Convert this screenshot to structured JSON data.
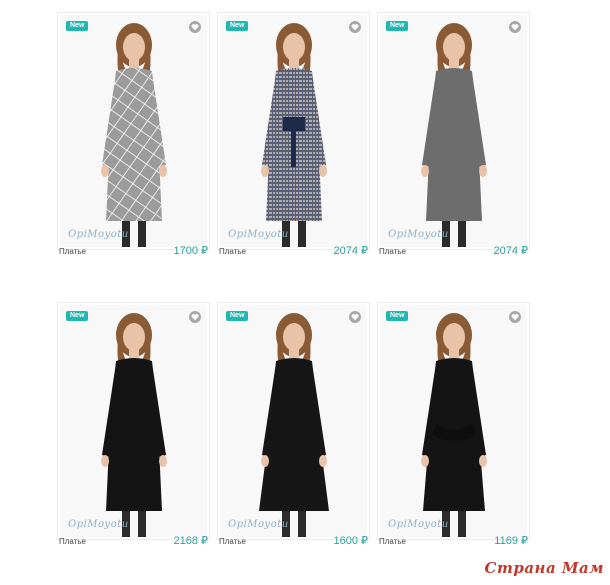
{
  "products": [
    {
      "badge": "New",
      "brand": "OpiMoyotu",
      "name": "Платье",
      "price": "1700 ₽",
      "dress": "#9b9b9b",
      "accent": "#ffffff"
    },
    {
      "badge": "New",
      "brand": "OpiMoyotu",
      "name": "Платье",
      "price": "2074 ₽",
      "dress": "#5a5f78",
      "accent": "#e8dcc8"
    },
    {
      "badge": "New",
      "brand": "OpiMoyotu",
      "name": "Платье",
      "price": "2074 ₽",
      "dress": "#6d6d6d",
      "accent": "#5a5a5a"
    },
    {
      "badge": "New",
      "brand": "OpiMoyotu",
      "name": "Платье",
      "price": "2168 ₽",
      "dress": "#141414",
      "accent": "#2a2a2a"
    },
    {
      "badge": "New",
      "brand": "OpiMoyotu",
      "name": "Платье",
      "price": "1600 ₽",
      "dress": "#161616",
      "accent": "#2a2a2a"
    },
    {
      "badge": "New",
      "brand": "OpiMoyotu",
      "name": "Платье",
      "price": "1169 ₽",
      "dress": "#141414",
      "accent": "#2a2a2a"
    }
  ],
  "icons": {
    "favorite": "heart-icon"
  },
  "colors": {
    "badge": "#21b6b0",
    "price": "#2a9fa0",
    "watermark": "#c0392b"
  },
  "watermark": "Страна Мам"
}
